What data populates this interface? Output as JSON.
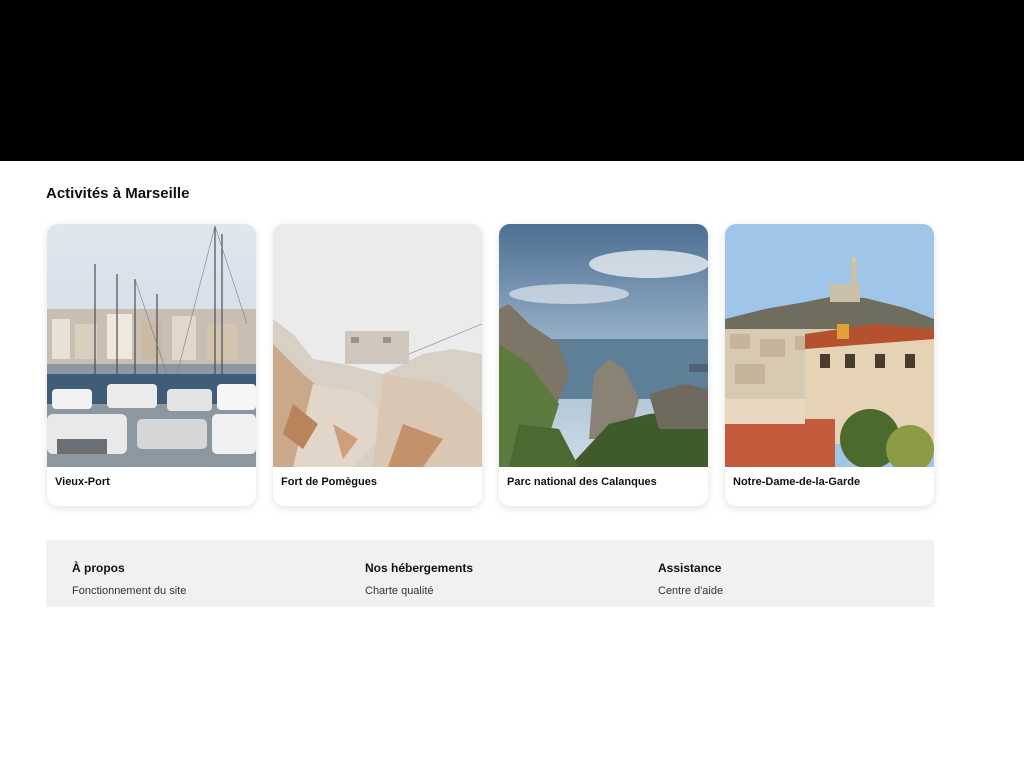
{
  "section": {
    "title": "Activités à Marseille"
  },
  "activities": [
    {
      "label": "Vieux-Port"
    },
    {
      "label": "Fort de Pomègues"
    },
    {
      "label": "Parc national des Calanques"
    },
    {
      "label": "Notre-Dame-de-la-Garde"
    }
  ],
  "footer": {
    "columns": [
      {
        "heading": "À propos",
        "links": [
          "Fonctionnement du site"
        ]
      },
      {
        "heading": "Nos hébergements",
        "links": [
          "Charte qualité"
        ]
      },
      {
        "heading": "Assistance",
        "links": [
          "Centre d'aide"
        ]
      }
    ]
  }
}
